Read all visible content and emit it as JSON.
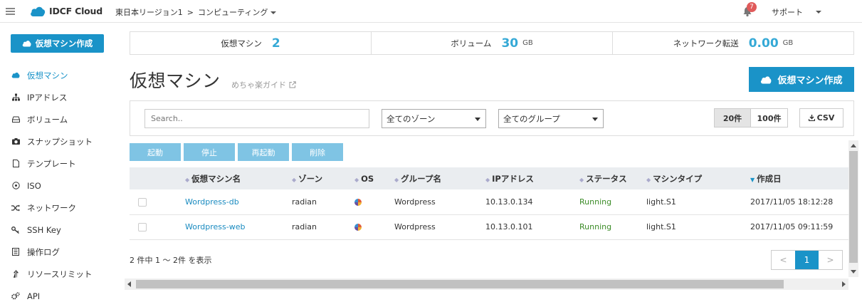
{
  "app": {
    "logo_text": "IDCF Cloud"
  },
  "header": {
    "region": "東日本リージョン1",
    "separator": ">",
    "service": "コンピューティング",
    "notification_count": "7",
    "support": "サポート"
  },
  "sidebar": {
    "create_button": "仮想マシン作成",
    "items": [
      {
        "label": "仮想マシン",
        "icon": "cloud-icon",
        "active": true
      },
      {
        "label": "IPアドレス",
        "icon": "sitemap-icon"
      },
      {
        "label": "ボリューム",
        "icon": "hdd-icon"
      },
      {
        "label": "スナップショット",
        "icon": "camera-icon"
      },
      {
        "label": "テンプレート",
        "icon": "file-icon"
      },
      {
        "label": "ISO",
        "icon": "disc-icon"
      },
      {
        "label": "ネットワーク",
        "icon": "shuffle-icon"
      },
      {
        "label": "SSH Key",
        "icon": "key-icon"
      },
      {
        "label": "操作ログ",
        "icon": "log-icon"
      },
      {
        "label": "リソースリミット",
        "icon": "limit-icon"
      },
      {
        "label": "API",
        "icon": "cogs-icon"
      }
    ]
  },
  "summary": {
    "vm_label": "仮想マシン",
    "vm_count": "2",
    "volume_label": "ボリューム",
    "volume_value": "30",
    "volume_unit": "GB",
    "network_label": "ネットワーク転送",
    "network_value": "0.00",
    "network_unit": "GB"
  },
  "page": {
    "title": "仮想マシン",
    "guide": "めちゃ楽ガイド",
    "create_button": "仮想マシン作成"
  },
  "filter": {
    "search_placeholder": "Search..",
    "zone_select": "全てのゾーン",
    "group_select": "全てのグループ",
    "page_size_20": "20件",
    "page_size_100": "100件",
    "csv": "CSV"
  },
  "actions": {
    "start": "起動",
    "stop": "停止",
    "restart": "再起動",
    "delete": "削除"
  },
  "table": {
    "headers": {
      "name": "仮想マシン名",
      "zone": "ゾーン",
      "os": "OS",
      "group": "グループ名",
      "ip": "IPアドレス",
      "status": "ステータス",
      "type": "マシンタイプ",
      "created": "作成日"
    },
    "rows": [
      {
        "name": "Wordpress-db",
        "zone": "radian",
        "group": "Wordpress",
        "ip": "10.13.0.134",
        "status": "Running",
        "type": "light.S1",
        "created": "2017/11/05 18:12:28"
      },
      {
        "name": "Wordpress-web",
        "zone": "radian",
        "group": "Wordpress",
        "ip": "10.13.0.101",
        "status": "Running",
        "type": "light.S1",
        "created": "2017/11/05 09:11:59"
      }
    ]
  },
  "footer": {
    "count_text": "2 件中 1 ～ 2件 を表示",
    "pager_prev": "<",
    "pager_current": "1",
    "pager_next": ">"
  },
  "colors": {
    "accent": "#1a93c8",
    "running": "#3c8c28",
    "action_button": "#7fc4e4"
  }
}
